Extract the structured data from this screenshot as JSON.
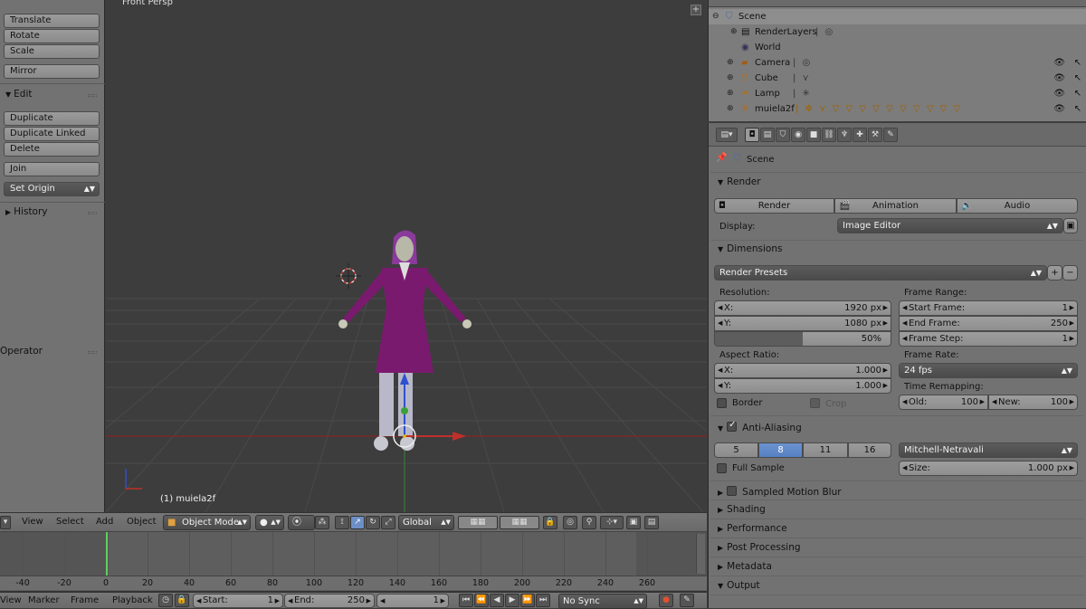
{
  "tool_shelf": {
    "transform_buttons": [
      "Translate",
      "Rotate",
      "Scale"
    ],
    "mirror": "Mirror",
    "edit_panel": "Edit",
    "edit_buttons": [
      "Duplicate",
      "Duplicate Linked",
      "Delete"
    ],
    "join": "Join",
    "set_origin": "Set Origin",
    "history_panel": "History",
    "operator_panel": "Operator"
  },
  "viewport": {
    "view_label": "Front Persp",
    "object_label": "(1) muiela2f"
  },
  "outliner": {
    "rows": [
      {
        "label": "Scene",
        "icon": "scene-icon"
      },
      {
        "label": "RenderLayers",
        "icon": "render-layers-icon"
      },
      {
        "label": "World",
        "icon": "world-icon"
      },
      {
        "label": "Camera",
        "icon": "camera-icon"
      },
      {
        "label": "Cube",
        "icon": "mesh-icon"
      },
      {
        "label": "Lamp",
        "icon": "lamp-icon"
      },
      {
        "label": "muiela2f",
        "icon": "armature-icon"
      }
    ]
  },
  "properties": {
    "context": "Scene",
    "render_panel": "Render",
    "render_buttons": [
      "Render",
      "Animation",
      "Audio"
    ],
    "display_label": "Display:",
    "display_value": "Image Editor",
    "dimensions_panel": "Dimensions",
    "render_presets": "Render Presets",
    "resolution_label": "Resolution:",
    "res_x_label": "X:",
    "res_x": "1920 px",
    "res_y_label": "Y:",
    "res_y": "1080 px",
    "res_percent": "50%",
    "res_percent_value": 50,
    "frame_range_label": "Frame Range:",
    "start_frame_label": "Start Frame:",
    "start_frame": "1",
    "end_frame_label": "End Frame:",
    "end_frame": "250",
    "frame_step_label": "Frame Step:",
    "frame_step": "1",
    "aspect_label": "Aspect Ratio:",
    "asp_x_label": "X:",
    "asp_x": "1.000",
    "asp_y_label": "Y:",
    "asp_y": "1.000",
    "frame_rate_label": "Frame Rate:",
    "frame_rate": "24 fps",
    "time_remap_label": "Time Remapping:",
    "old_label": "Old:",
    "old": "100",
    "new_label": "New:",
    "new": "100",
    "border": "Border",
    "crop": "Crop",
    "aa_panel": "Anti-Aliasing",
    "aa_samples": [
      "5",
      "8",
      "11",
      "16"
    ],
    "aa_selected": "8",
    "aa_filter": "Mitchell-Netravali",
    "full_sample": "Full Sample",
    "size_label": "Size:",
    "size": "1.000 px",
    "collapsed_panels": [
      "Sampled Motion Blur",
      "Shading",
      "Performance",
      "Post Processing",
      "Metadata",
      "Output"
    ]
  },
  "header3d": {
    "menus": [
      "View",
      "Select",
      "Add",
      "Object"
    ],
    "mode": "Object Mode",
    "orientation": "Global"
  },
  "timeline": {
    "ticks": [
      "-40",
      "-20",
      "0",
      "20",
      "40",
      "60",
      "80",
      "100",
      "120",
      "140",
      "160",
      "180",
      "200",
      "220",
      "240",
      "260"
    ],
    "current_frame": 1
  },
  "timeline_bar": {
    "menus": [
      "View",
      "Marker",
      "Frame",
      "Playback"
    ],
    "start_label": "Start:",
    "start": "1",
    "end_label": "End:",
    "end": "250",
    "current": "1",
    "sync": "No Sync"
  },
  "colors": {
    "selection_blue": "#5680c2",
    "dress": "#7a1a6e",
    "x_axis": "#c0302a",
    "y_axis": "#3aa03a",
    "z_axis": "#3050d0"
  }
}
